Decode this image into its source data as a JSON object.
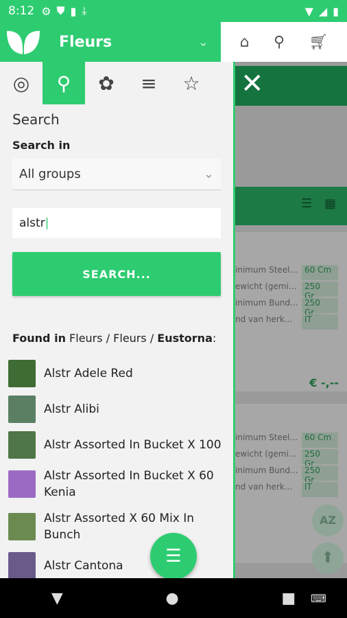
{
  "status": {
    "time": "8:12"
  },
  "appbar": {
    "title": "Fleurs"
  },
  "drawer": {
    "section_title": "Search",
    "search_in_label": "Search in",
    "group_select_value": "All groups",
    "search_value": "alstr",
    "search_button": "SEARCH...",
    "found_prefix": "Found in",
    "found_path_1": "Fleurs",
    "found_sep": "/",
    "found_path_2": "Fleurs",
    "found_last": "Eustorna",
    "found_colon": ":",
    "results": [
      {
        "name": "Alstr Adele Red"
      },
      {
        "name": "Alstr Alibi"
      },
      {
        "name": "Alstr Assorted In Bucket X 100"
      },
      {
        "name": "Alstr Assorted In Bucket X 60 Kenia"
      },
      {
        "name": "Alstr Assorted X 60 Mix In Bunch"
      },
      {
        "name": "Alstr Cantona"
      }
    ]
  },
  "background": {
    "card1": [
      {
        "k": "inimum Steel...",
        "v": "60 Cm"
      },
      {
        "k": "ewicht (gemi...",
        "v": "250 Gr..."
      },
      {
        "k": "inimum Bund...",
        "v": "250 Gr..."
      },
      {
        "k": "nd van herk...",
        "v": "IT"
      }
    ],
    "card2": [
      {
        "k": "inimum Steel...",
        "v": "60 Cm"
      },
      {
        "k": "ewicht (gemi...",
        "v": "250 Gr..."
      },
      {
        "k": "inimum Bund...",
        "v": "250 Gr..."
      },
      {
        "k": "nd van herk...",
        "v": "IT"
      }
    ],
    "price": "€ -,--",
    "az": "AZ"
  }
}
